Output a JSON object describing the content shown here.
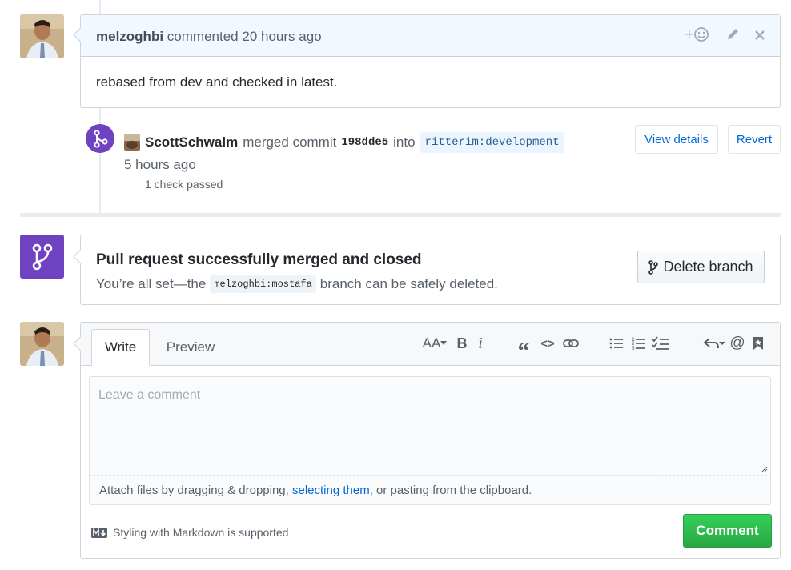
{
  "comment": {
    "author": "melzoghbi",
    "action": "commented",
    "time": "20 hours ago",
    "body": "rebased from dev and checked in latest.",
    "actions": {
      "reaction_icon": "add-reaction-icon",
      "edit_icon": "pencil-icon",
      "delete_icon": "close-icon"
    }
  },
  "merge_event": {
    "actor": "ScottSchwalm",
    "action": "merged commit",
    "sha": "198dde5",
    "into": "into",
    "target_branch": "ritterim:development",
    "time": "5 hours ago",
    "checks": "1 check passed",
    "view_details_label": "View details",
    "revert_label": "Revert"
  },
  "merged_status": {
    "title": "Pull request successfully merged and closed",
    "prefix": "You’re all set—the",
    "branch": "melzoghbi:mostafa",
    "suffix": "branch can be safely deleted.",
    "delete_button_label": "Delete branch"
  },
  "new_comment": {
    "tabs": [
      "Write",
      "Preview"
    ],
    "toolbar": {
      "heading": "AA",
      "bold": "B",
      "italic": "i",
      "quote": "“",
      "code": "<>",
      "at": "@"
    },
    "placeholder": "Leave a comment",
    "attach_prefix": "Attach files by dragging & dropping, ",
    "attach_link": "selecting them",
    "attach_suffix": ", or pasting from the clipboard.",
    "markdown_note": "Styling with Markdown is supported",
    "submit_label": "Comment"
  },
  "colors": {
    "merged_purple": "#6f42c1",
    "link_blue": "#0366d6",
    "comment_green": "#28a745",
    "header_blue": "#f1f8ff"
  }
}
